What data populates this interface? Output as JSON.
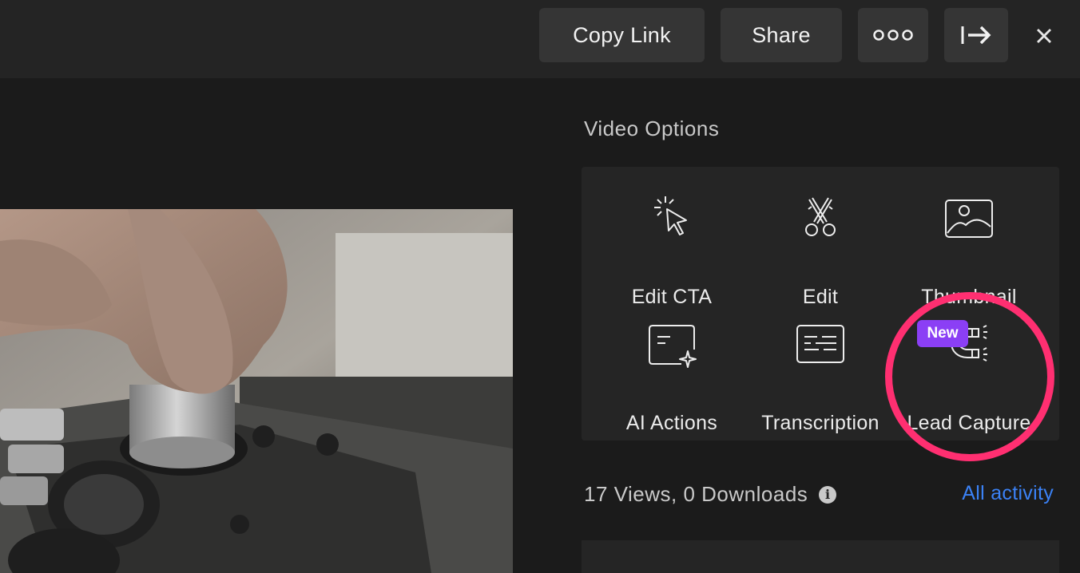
{
  "toolbar": {
    "copy_link_label": "Copy Link",
    "share_label": "Share",
    "more_icon": "more-dots-icon",
    "exit_icon": "arrow-right-bar-icon",
    "close_icon": "close-icon"
  },
  "sidebar": {
    "title": "Video Options",
    "options": [
      {
        "label": "Edit CTA",
        "icon": "cursor-sparkle-icon"
      },
      {
        "label": "Edit",
        "icon": "scissors-icon"
      },
      {
        "label": "Thumbnail",
        "icon": "image-icon"
      },
      {
        "label": "AI Actions",
        "icon": "ai-sparkle-card-icon"
      },
      {
        "label": "Transcription",
        "icon": "transcript-icon"
      },
      {
        "label": "Lead Capture",
        "icon": "magnet-icon",
        "badge": "New"
      }
    ],
    "stats_text": "17 Views, 0 Downloads",
    "stats_info_icon": "info-icon",
    "all_activity_label": "All activity"
  },
  "colors": {
    "accent_link": "#3b82f6",
    "badge": "#8b3ff5",
    "highlight_ring": "#ff2f71",
    "background": "#1b1b1b",
    "panel": "#252525"
  }
}
